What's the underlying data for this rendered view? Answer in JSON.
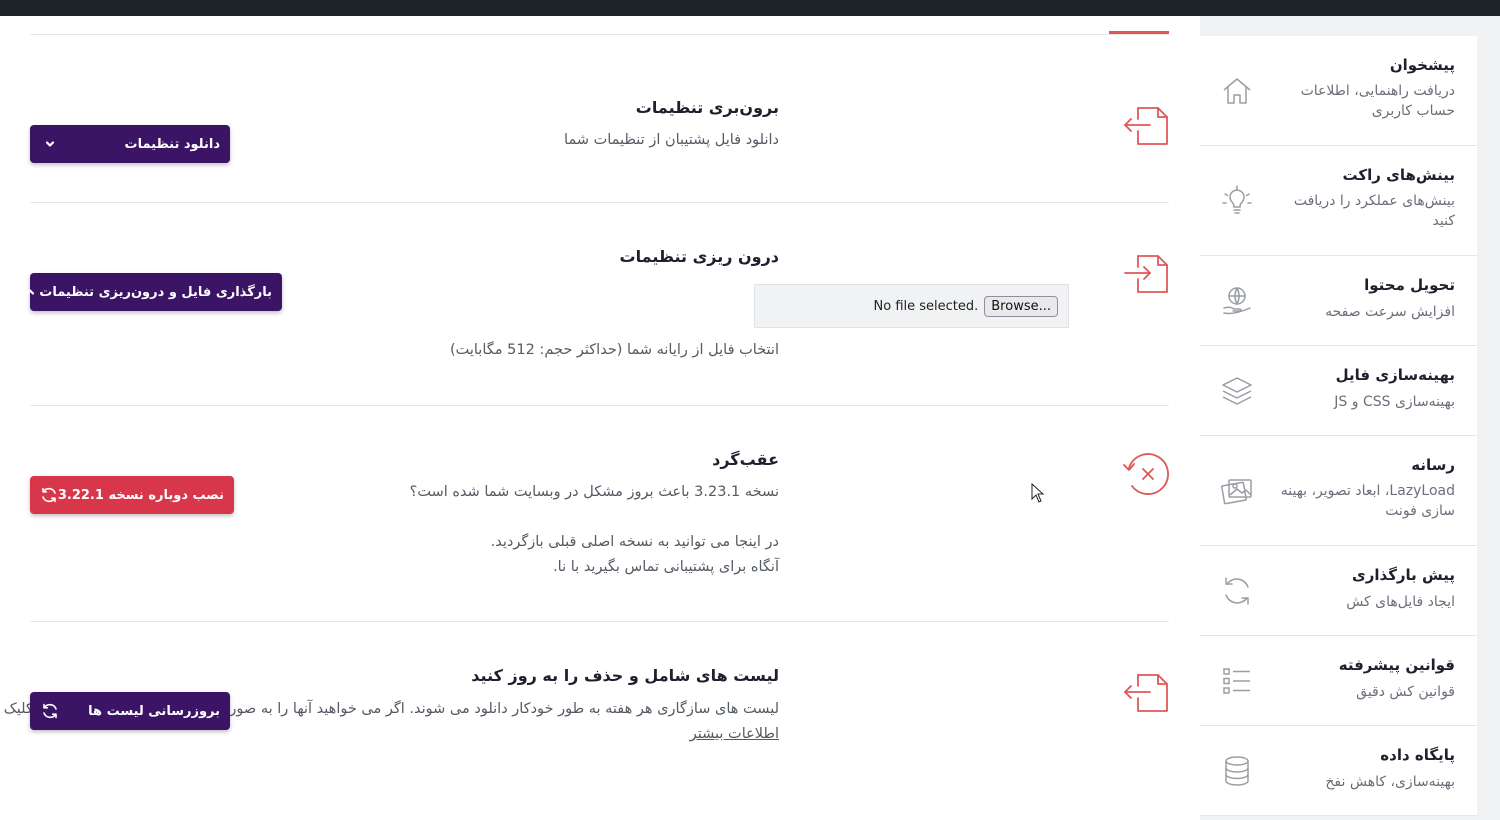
{
  "sidebar": {
    "items": [
      {
        "title": "پیشخوان",
        "desc": "دریافت راهنمایی، اطلاعات حساب کاربری",
        "icon": "home-icon"
      },
      {
        "title": "بینش‌های راکت",
        "desc": "بینش‌های عملکرد را دریافت کنید",
        "icon": "lightbulb-icon"
      },
      {
        "title": "تحویل محتوا",
        "desc": "افزایش سرعت صفحه",
        "icon": "globe-hand-icon"
      },
      {
        "title": "بهینه‌سازی فایل",
        "desc": "بهینه‌سازی CSS و JS",
        "icon": "layers-icon"
      },
      {
        "title": "رسانه",
        "desc": "LazyLoad، ابعاد تصویر، بهینه سازی فونت",
        "icon": "images-icon"
      },
      {
        "title": "پیش بارگذاری",
        "desc": "ایجاد فایل‌های کش",
        "icon": "refresh-icon"
      },
      {
        "title": "قوانین پیشرفته",
        "desc": "قوانین کش دقیق",
        "icon": "checklist-icon"
      },
      {
        "title": "پایگاه داده",
        "desc": "بهینه‌سازی، کاهش نفخ",
        "icon": "database-icon"
      }
    ]
  },
  "export": {
    "title": "برون‌بری تنظیمات",
    "desc": "دانلود فایل پشتیبان از تنظیمات شما",
    "button": "دانلود تنظیمات",
    "icon": "export-file-icon"
  },
  "import": {
    "title": "درون ریزی تنظیمات",
    "browse": "Browse...",
    "file_status": "No file selected.",
    "hint": "انتخاب فایل از رایانه شما (حداکثر حجم: 512 مگابایت)",
    "button": "بارگذاری فایل و درون‌ریزی تنظیمات",
    "icon": "import-file-icon"
  },
  "rollback": {
    "title": "عقب‌گرد",
    "line1": "نسخه 3.23.1 باعث بروز مشکل در وبسایت شما شده است؟",
    "line2": "در اینجا می توانید به نسخه اصلی قبلی بازگردید.",
    "line3": "آنگاه برای پشتیبانی تماس بگیرید با نا.",
    "button": "نصب دوباره نسخه 3.22.1",
    "icon": "rollback-icon"
  },
  "lists": {
    "title": "لیست های شامل و حذف را به روز کنید",
    "desc": "لیست های سازگاری هر هفته به طور خودکار دانلود می شوند. اگر می خواهید آنها را به صورت دستی به روز کنید، روی دکمه کلیک کنید.",
    "link": "اطلاعات بیشتر",
    "button": "بروزرسانی لیست ها",
    "icon": "update-file-icon"
  },
  "colors": {
    "purple": "#3b1466",
    "red": "#d8374b",
    "accent_line": "#e05757",
    "cdn_tab": "#2a6be6"
  }
}
